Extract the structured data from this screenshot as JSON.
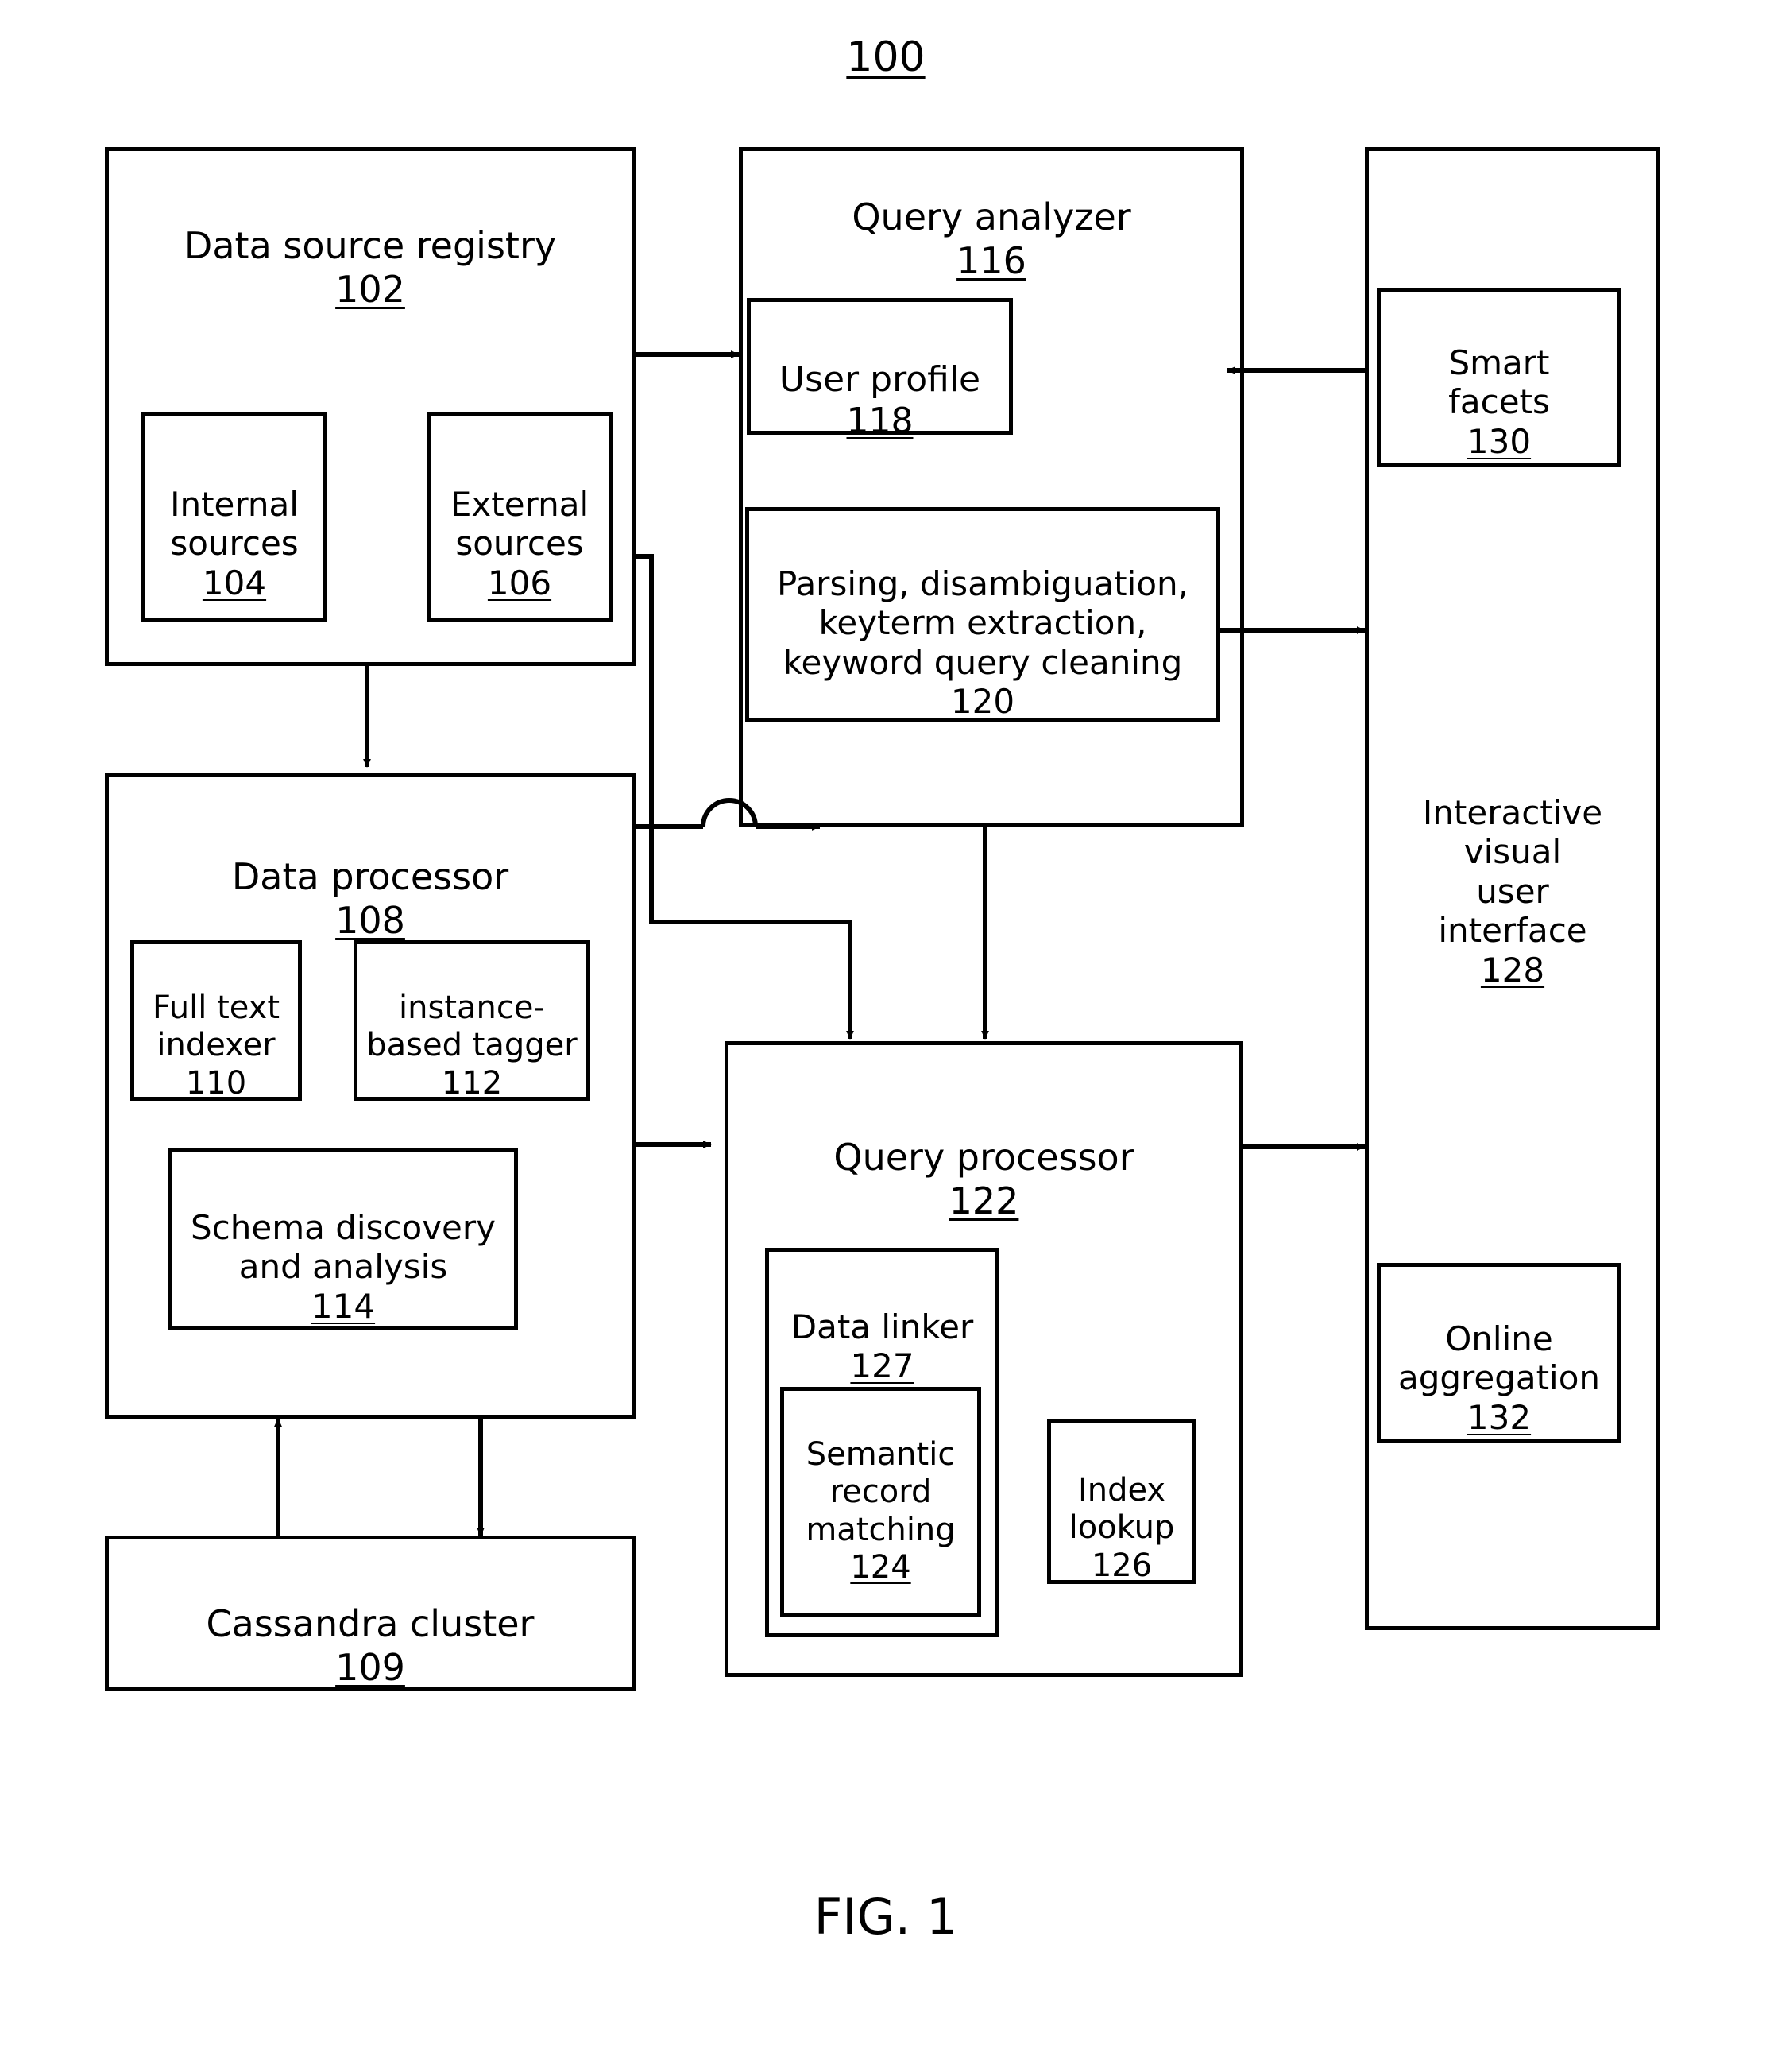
{
  "figure": {
    "ref_number": "100",
    "caption": "FIG. 1"
  },
  "blocks": {
    "data_source_registry": {
      "title": "Data source registry",
      "ref": "102"
    },
    "internal_sources": {
      "title": "Internal\nsources",
      "ref": "104"
    },
    "external_sources": {
      "title": "External\nsources",
      "ref": "106"
    },
    "data_processor": {
      "title": "Data processor",
      "ref": "108"
    },
    "cassandra_cluster": {
      "title": "Cassandra cluster",
      "ref": "109"
    },
    "full_text_indexer": {
      "title": "Full text\nindexer",
      "ref": "110"
    },
    "instance_based_tagger": {
      "title": "instance-\nbased tagger",
      "ref": "112"
    },
    "schema_discovery": {
      "title": "Schema discovery\nand analysis",
      "ref": "114"
    },
    "query_analyzer": {
      "title": "Query analyzer",
      "ref": "116"
    },
    "user_profile": {
      "title": "User profile",
      "ref": "118"
    },
    "parsing": {
      "title": "Parsing, disambiguation,\nkeyterm extraction,\nkeyword query cleaning",
      "ref": "120"
    },
    "query_processor": {
      "title": "Query processor",
      "ref": "122"
    },
    "semantic_record_matching": {
      "title": "Semantic\nrecord\nmatching",
      "ref": "124"
    },
    "index_lookup": {
      "title": "Index\nlookup",
      "ref": "126"
    },
    "data_linker": {
      "title": "Data linker",
      "ref": "127"
    },
    "interactive_ui": {
      "title": "Interactive\nvisual\nuser\ninterface",
      "ref": "128"
    },
    "smart_facets": {
      "title": "Smart\nfacets",
      "ref": "130"
    },
    "online_aggregation": {
      "title": "Online\naggregation",
      "ref": "132"
    }
  },
  "connectors": [
    {
      "name": "registry-to-query-analyzer",
      "from": "data_source_registry",
      "to": "query_analyzer",
      "type": "arrow"
    },
    {
      "name": "registry-to-data-processor",
      "from": "data_source_registry",
      "to": "data_processor",
      "type": "arrow"
    },
    {
      "name": "external-sources-to-query-processor",
      "from": "external_sources",
      "to": "query_processor",
      "type": "arrow"
    },
    {
      "name": "external-sources-to-query-analyzer",
      "from": "external_sources",
      "to": "query_analyzer",
      "type": "arrow-with-hop"
    },
    {
      "name": "data-processor-to-query-analyzer",
      "from": "data_processor",
      "to": "query_analyzer",
      "type": "arrow-with-hop"
    },
    {
      "name": "data-processor-to-query-processor",
      "from": "data_processor",
      "to": "query_processor",
      "type": "arrow"
    },
    {
      "name": "data-processor-to-cassandra",
      "from": "data_processor",
      "to": "cassandra_cluster",
      "type": "arrow"
    },
    {
      "name": "cassandra-to-data-processor",
      "from": "cassandra_cluster",
      "to": "data_processor",
      "type": "arrow"
    },
    {
      "name": "query-analyzer-to-query-processor",
      "from": "query_analyzer",
      "to": "query_processor",
      "type": "arrow"
    },
    {
      "name": "parsing-to-interactive-ui",
      "from": "parsing",
      "to": "interactive_ui",
      "type": "arrow"
    },
    {
      "name": "smart-facets-to-query-analyzer",
      "from": "smart_facets",
      "to": "query_analyzer",
      "type": "arrow"
    },
    {
      "name": "query-processor-to-interactive-ui",
      "from": "query_processor",
      "to": "interactive_ui",
      "type": "arrow"
    }
  ]
}
